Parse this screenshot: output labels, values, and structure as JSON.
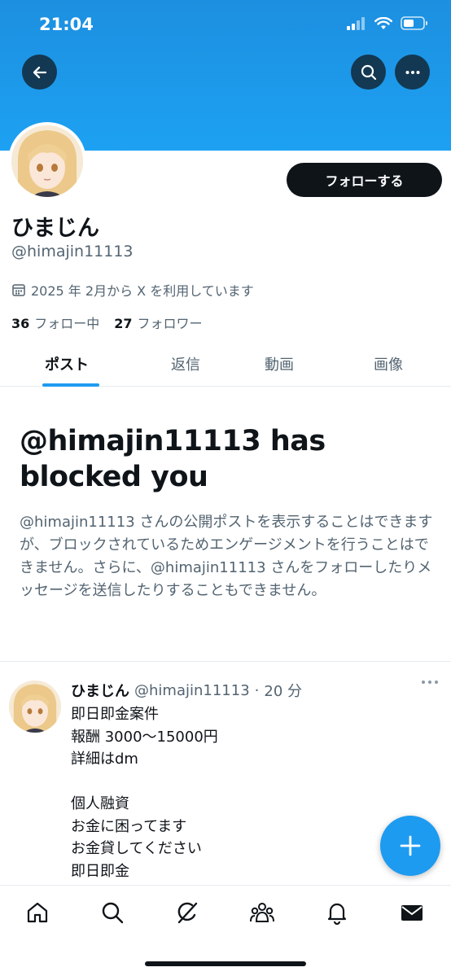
{
  "status_bar": {
    "time": "21:04"
  },
  "header": {
    "back_icon": "back-arrow-icon",
    "search_icon": "search-icon",
    "more_icon": "more-icon"
  },
  "profile": {
    "display_name": "ひまじん",
    "handle": "@himajin11113",
    "joined": "2025 年 2月から X を利用しています",
    "following_count": "36",
    "following_label": "フォロー中",
    "followers_count": "27",
    "followers_label": "フォロワー",
    "follow_button": "フォローする"
  },
  "tabs": [
    {
      "label": "ポスト",
      "active": true
    },
    {
      "label": "返信"
    },
    {
      "label": "動画"
    },
    {
      "label": "画像"
    }
  ],
  "blocked": {
    "title": "@himajin11113 has blocked you",
    "description": "@himajin11113 さんの公開ポストを表示することはできますが、ブロックされているためエンゲージメントを行うことはできません。さらに、@himajin11113 さんをフォローしたりメッセージを送信したりすることもできません。"
  },
  "post": {
    "name": "ひまじん",
    "handle": "@himajin11113",
    "separator": "·",
    "time": "20 分",
    "lines": [
      "即日即金案件",
      "報酬 3000〜15000円",
      "詳細はdm",
      "",
      "個人融資",
      "お金に困ってます",
      "お金貸してください",
      "即日即金"
    ]
  },
  "bottom_nav": [
    "home-icon",
    "search-icon",
    "grok-icon",
    "communities-icon",
    "notifications-icon",
    "messages-icon"
  ],
  "colors": {
    "accent": "#1d9bf0",
    "text": "#0f1419",
    "secondary": "#536471",
    "banner": "#1da1f2"
  }
}
